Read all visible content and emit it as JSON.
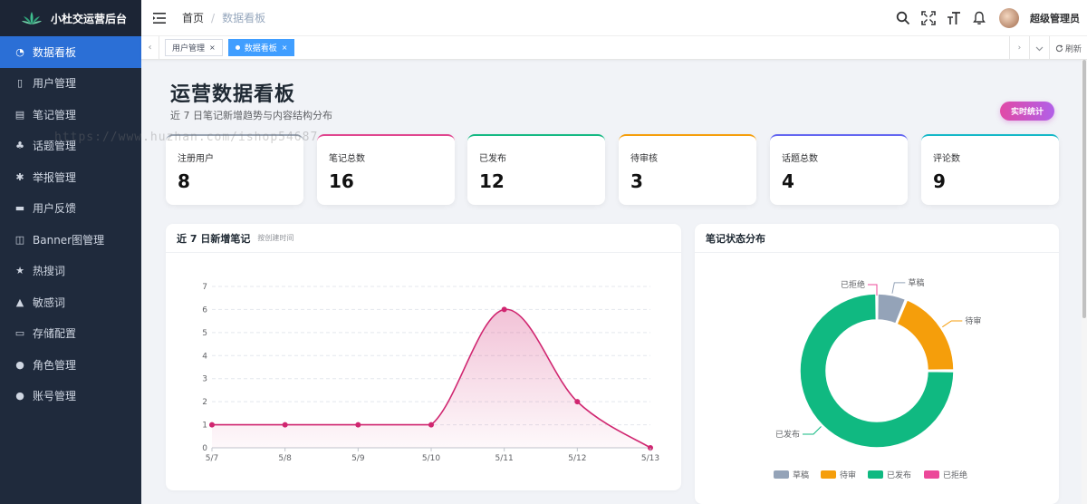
{
  "app": {
    "title": "小杜交运营后台"
  },
  "sidebar": {
    "items": [
      {
        "label": "数据看板",
        "icon": "dashboard-icon",
        "active": true
      },
      {
        "label": "用户管理",
        "icon": "phone-icon"
      },
      {
        "label": "笔记管理",
        "icon": "note-icon"
      },
      {
        "label": "话题管理",
        "icon": "sitemap-icon"
      },
      {
        "label": "举报管理",
        "icon": "bug-icon"
      },
      {
        "label": "用户反馈",
        "icon": "comment-icon"
      },
      {
        "label": "Banner图管理",
        "icon": "book-icon"
      },
      {
        "label": "热搜词",
        "icon": "star-icon"
      },
      {
        "label": "敏感词",
        "icon": "lock-icon"
      },
      {
        "label": "存储配置",
        "icon": "monitor-icon"
      },
      {
        "label": "角色管理",
        "icon": "users-icon"
      },
      {
        "label": "账号管理",
        "icon": "user-icon"
      }
    ]
  },
  "header": {
    "breadcrumb": {
      "home": "首页",
      "sep": "/",
      "current": "数据看板"
    },
    "username": "超级管理员"
  },
  "tags": {
    "items": [
      {
        "label": "用户管理",
        "close": "×",
        "active": false
      },
      {
        "label": "数据看板",
        "close": "×",
        "active": true
      }
    ],
    "refresh": "刷新"
  },
  "main": {
    "title": "运营数据看板",
    "subtitle": "近 7 日笔记新增趋势与内容结构分布",
    "realtime_label": "实时统计"
  },
  "stats": [
    {
      "label": "注册用户",
      "value": "8",
      "color": "#9aa4b2"
    },
    {
      "label": "笔记总数",
      "value": "16",
      "color": "#e0468f"
    },
    {
      "label": "已发布",
      "value": "12",
      "color": "#15b983"
    },
    {
      "label": "待审核",
      "value": "3",
      "color": "#f59e0b"
    },
    {
      "label": "话题总数",
      "value": "4",
      "color": "#6366f1"
    },
    {
      "label": "评论数",
      "value": "9",
      "color": "#14b8c8"
    }
  ],
  "watermark": "https://www.huzhan.com/ishop54687",
  "panels": {
    "line": {
      "title": "近 7 日新增笔记",
      "hint": "按创建时间"
    },
    "pie": {
      "title": "笔记状态分布"
    }
  },
  "chart_data": [
    {
      "type": "line",
      "title": "近 7 日新增笔记",
      "categories": [
        "5/7",
        "5/8",
        "5/9",
        "5/10",
        "5/11",
        "5/12",
        "5/13"
      ],
      "values": [
        1,
        1,
        1,
        1,
        6,
        2,
        0
      ],
      "ylim": [
        0,
        7
      ],
      "yticks": [
        0,
        1,
        2,
        3,
        4,
        5,
        6,
        7
      ],
      "grid": true,
      "color": "#d02670"
    },
    {
      "type": "pie",
      "title": "笔记状态分布",
      "donut": true,
      "labels": [
        "草稿",
        "待审",
        "已发布",
        "已拒绝"
      ],
      "values": [
        1,
        3,
        12,
        0
      ],
      "colors": [
        "#94a3b8",
        "#f59e0b",
        "#10b981",
        "#ec4899"
      ],
      "legend": "bottom"
    }
  ]
}
